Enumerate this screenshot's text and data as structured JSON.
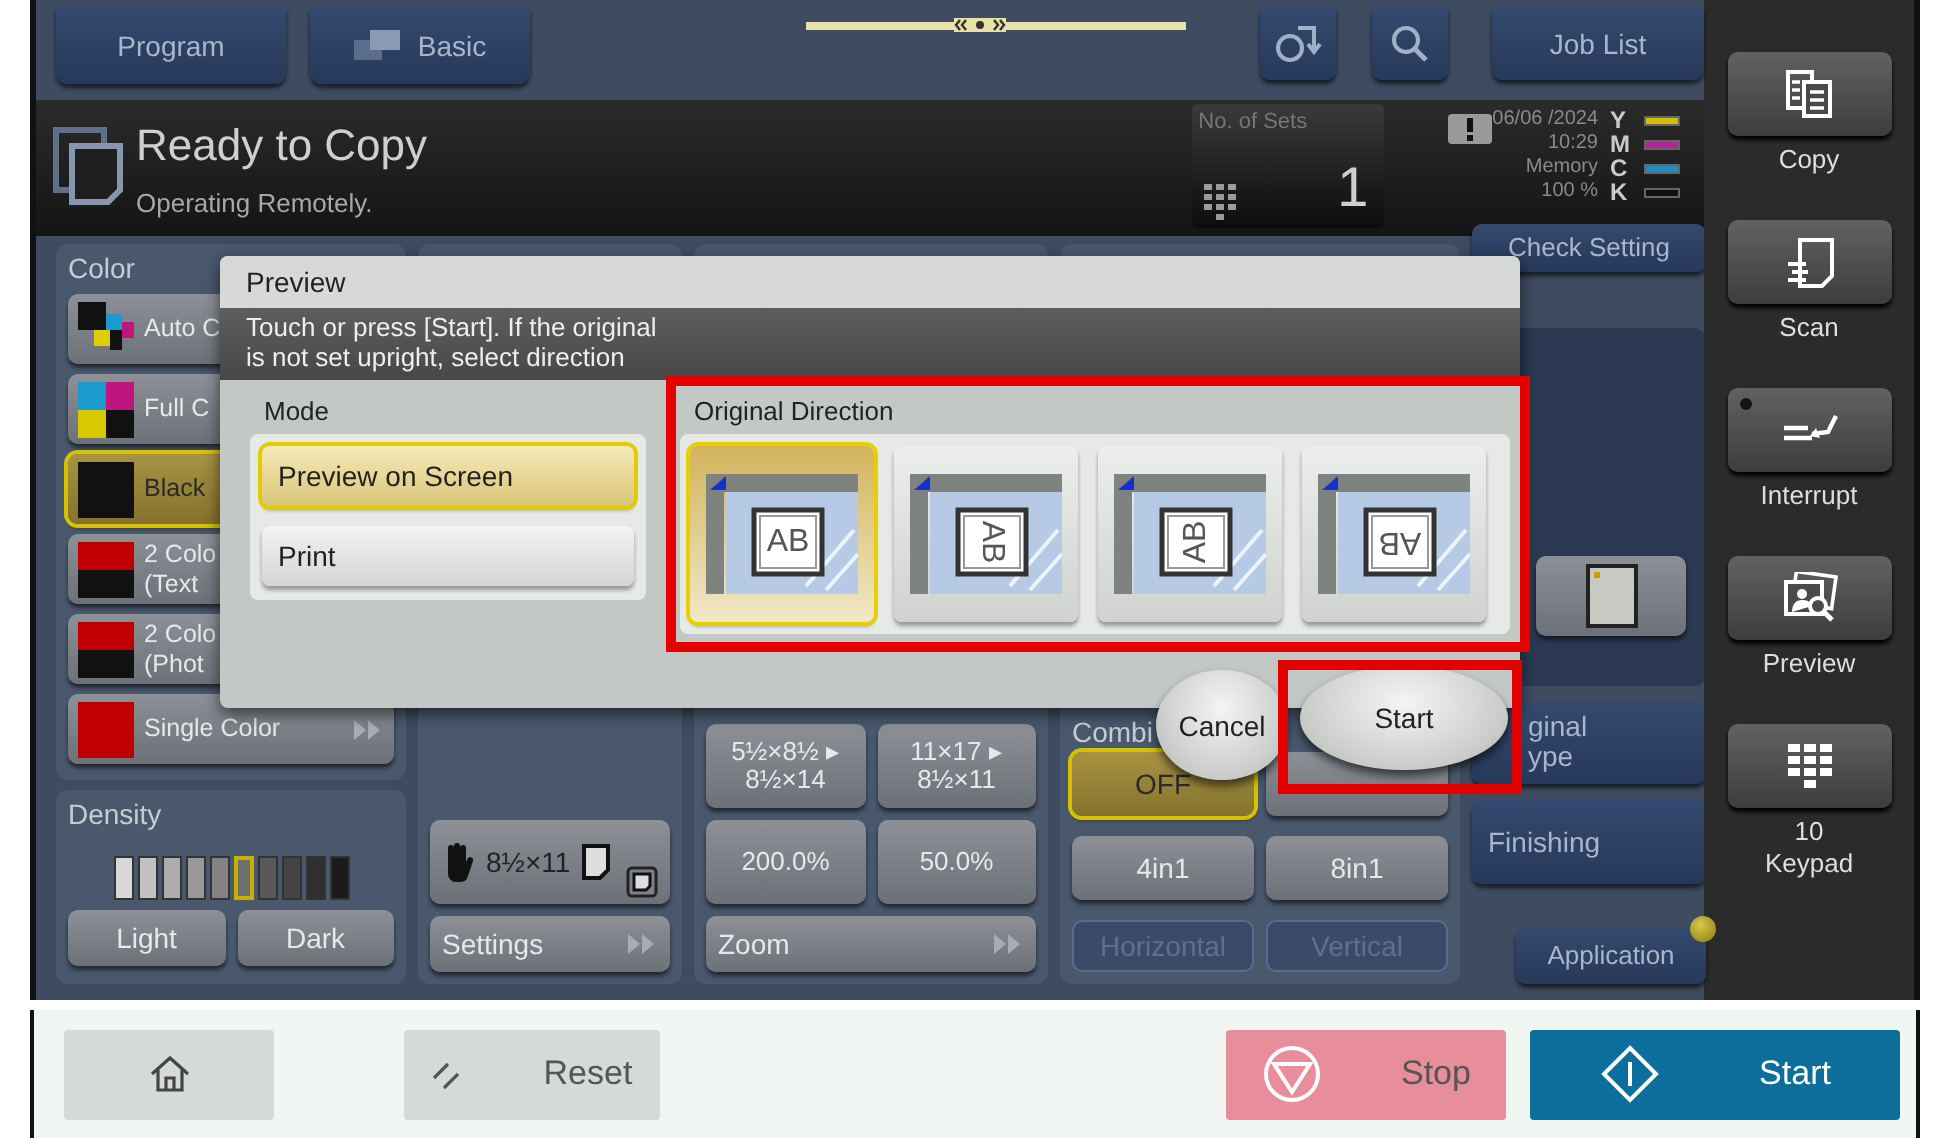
{
  "top_tabs": [
    {
      "label": "Program",
      "kind": "plain"
    },
    {
      "label": "Basic",
      "kind": "icon"
    }
  ],
  "job_list": "Job List",
  "status": {
    "title": "Ready to Copy",
    "subtitle": "Operating Remotely.",
    "sets_label": "No. of Sets",
    "sets_value": "1",
    "date": "06/06 /2024",
    "time": "10:29",
    "memory_label": "Memory",
    "memory_value": "100 %",
    "toners": [
      {
        "letter": "Y",
        "color": "#d4c000"
      },
      {
        "letter": "M",
        "color": "#b3259a"
      },
      {
        "letter": "C",
        "color": "#1e8fc4"
      },
      {
        "letter": "K",
        "color": "#111111"
      }
    ]
  },
  "color_panel": {
    "title": "Color",
    "options": [
      {
        "label": "Auto C",
        "kind": "auto",
        "selected": false
      },
      {
        "label": "Full C",
        "kind": "full",
        "selected": false
      },
      {
        "label": "Black",
        "kind": "black",
        "selected": true
      },
      {
        "label": "2 Colo\n(Text",
        "kind": "two_color",
        "selected": false
      },
      {
        "label": "2 Colo\n(Phot",
        "kind": "two_color",
        "selected": false
      },
      {
        "label": "Single Color",
        "kind": "single",
        "selected": false
      }
    ]
  },
  "density": {
    "title": "Density",
    "level": 0.55,
    "buttons": [
      "Light",
      "Dark"
    ]
  },
  "paper": {
    "size": "8½×11",
    "settings": "Settings"
  },
  "zoom": {
    "presets": [
      "5½×8½ ▸\n8½×14",
      "11×17 ▸\n8½×11",
      "200.0%",
      "50.0%"
    ],
    "label": "Zoom"
  },
  "combine": {
    "title": "Combi",
    "options": [
      {
        "label": "OFF",
        "selected": true
      },
      {
        "selected": false
      },
      {
        "label": "4in1",
        "selected": false
      },
      {
        "label": "8in1",
        "selected": false
      }
    ],
    "layouts": [
      {
        "label": "Horizontal",
        "disabled": true
      },
      {
        "label": "Vertical",
        "disabled": true
      }
    ]
  },
  "right_column": {
    "check_setting": "Check Setting",
    "original_type": "ginal\nype",
    "finishing": "Finishing",
    "application": "Application"
  },
  "sidebar": [
    {
      "label": "Copy",
      "kind": "copy"
    },
    {
      "label": "Scan",
      "kind": "scan"
    },
    {
      "label": "Interrupt",
      "kind": "interrupt"
    },
    {
      "label": "Preview",
      "kind": "preview"
    },
    {
      "label": "10\nKeypad",
      "kind": "keypad"
    }
  ],
  "dialog": {
    "title": "Preview",
    "message": "Touch or press [Start]. If the original\nis not set upright, select direction",
    "mode_title": "Mode",
    "modes": [
      {
        "label": "Preview on Screen",
        "selected": true
      },
      {
        "label": "Print",
        "selected": false
      }
    ],
    "direction_title": "Original Direction",
    "directions": [
      {
        "kind": "mirrored",
        "letters": "AB",
        "selected": true
      },
      {
        "kind": "left",
        "letters": "AB",
        "selected": false
      },
      {
        "kind": "right",
        "letters": "AB",
        "selected": false
      },
      {
        "kind": "inverted",
        "letters": "AB",
        "selected": false
      }
    ],
    "cancel": "Cancel",
    "start": "Start"
  },
  "bottom_bar": {
    "reset": "Reset",
    "stop": "Stop",
    "start": "Start"
  }
}
